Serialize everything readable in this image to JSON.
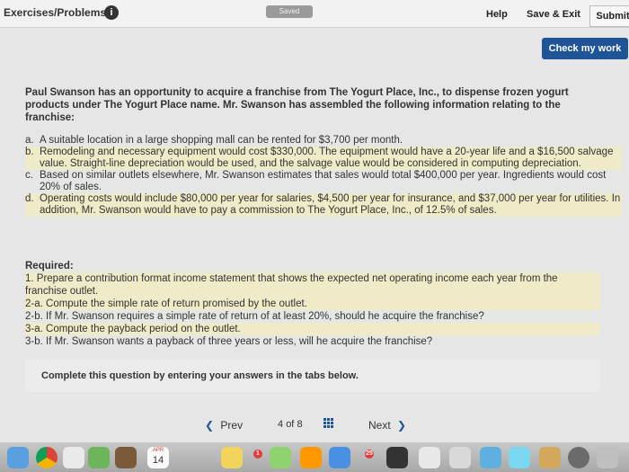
{
  "header": {
    "breadcrumb": "Exercises/Problems",
    "info_icon": "info-icon",
    "saved_label": "Saved",
    "help_label": "Help",
    "save_exit_label": "Save & Exit",
    "submit_label": "Submit"
  },
  "actions": {
    "check_label": "Check my work"
  },
  "problem": {
    "intro": "Paul Swanson has an opportunity to acquire a franchise from The Yogurt Place, Inc., to dispense frozen yogurt products under The Yogurt Place name. Mr. Swanson has assembled the following information relating to the franchise:",
    "items": [
      {
        "marker": "a.",
        "text": "A suitable location in a large shopping mall can be rented for $3,700 per month."
      },
      {
        "marker": "b.",
        "text": "Remodeling and necessary equipment would cost $330,000. The equipment would have a 20-year life and a $16,500 salvage value. Straight-line depreciation would be used, and the salvage value would be considered in computing depreciation."
      },
      {
        "marker": "c.",
        "text": "Based on similar outlets elsewhere, Mr. Swanson estimates that sales would total $400,000 per year. Ingredients would cost 20% of sales."
      },
      {
        "marker": "d.",
        "text": "Operating costs would include $80,000 per year for salaries, $4,500 per year for insurance, and $37,000 per year for utilities. In addition, Mr. Swanson would have to pay a commission to The Yogurt Place, Inc., of 12.5% of sales."
      }
    ],
    "required_header": "Required:",
    "required": [
      "1. Prepare a contribution format income statement that shows the expected net operating income each year from the franchise outlet.",
      "2-a. Compute the simple rate of return promised by the outlet.",
      "2-b. If Mr. Swanson requires a simple rate of return of at least 20%, should he acquire the franchise?",
      "3-a. Compute the payback period on the outlet.",
      "3-b. If Mr. Swanson wants a payback of three years or less, will he acquire the franchise?"
    ],
    "complete_instruction": "Complete this question by entering your answers in the tabs below."
  },
  "pager": {
    "prev_label": "Prev",
    "current": "4",
    "of_label": "of",
    "total": "8",
    "next_label": "Next"
  },
  "dock": {
    "calendar_month": "APR",
    "calendar_day": "14",
    "badge_a": "1",
    "badge_b": "25"
  },
  "colors": {
    "accent": "#1f5597",
    "highlight": "#efeac7"
  }
}
